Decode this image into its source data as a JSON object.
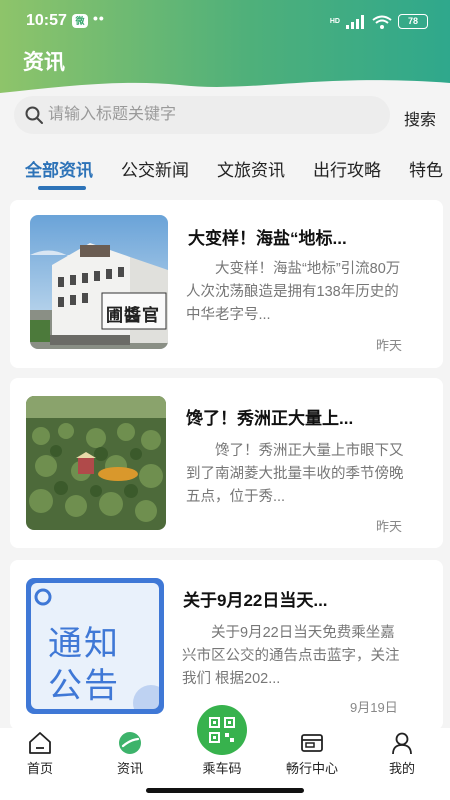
{
  "status_bar": {
    "time": "10:57",
    "app_badge": "微",
    "dots": "••",
    "network": "HD",
    "battery": "78"
  },
  "header": {
    "title": "资讯",
    "gradient_start": "#8ec46a",
    "gradient_end": "#2fa88c"
  },
  "search": {
    "placeholder": "请输入标题关键字",
    "value": "",
    "button_label": "搜索"
  },
  "tabs": [
    {
      "label": "全部资讯",
      "active": true
    },
    {
      "label": "公交新闻",
      "active": false
    },
    {
      "label": "文旅资讯",
      "active": false
    },
    {
      "label": "出行攻略",
      "active": false
    },
    {
      "label": "特色",
      "active": false
    }
  ],
  "accent_color": "#2d73b8",
  "articles": [
    {
      "title": "大变样！海盐“地标...",
      "summary": "大变样！海盐“地标”引流80万人次沈荡酿造是拥有138年历史的中华老字号...",
      "date": "昨天",
      "thumb_text": "圃醬官"
    },
    {
      "title": "馋了！秀洲正大量上...",
      "summary": "馋了！秀洲正大量上市眼下又到了南湖菱大批量丰收的季节傍晚五点，位于秀...",
      "date": "昨天"
    },
    {
      "title": "关于9月22日当天...",
      "summary": "关于9月22日当天免费乘坐嘉兴市区公交的通告点击蓝字，关注我们 根据202...",
      "date": "9月19日",
      "thumb_line1": "通知",
      "thumb_line2": "公告"
    }
  ],
  "bottom_nav": [
    {
      "label": "首页",
      "icon": "home-icon"
    },
    {
      "label": "资讯",
      "icon": "news-icon",
      "active": true
    },
    {
      "label": "乘车码",
      "icon": "qr-code-icon"
    },
    {
      "label": "畅行中心",
      "icon": "card-icon"
    },
    {
      "label": "我的",
      "icon": "user-icon"
    }
  ]
}
